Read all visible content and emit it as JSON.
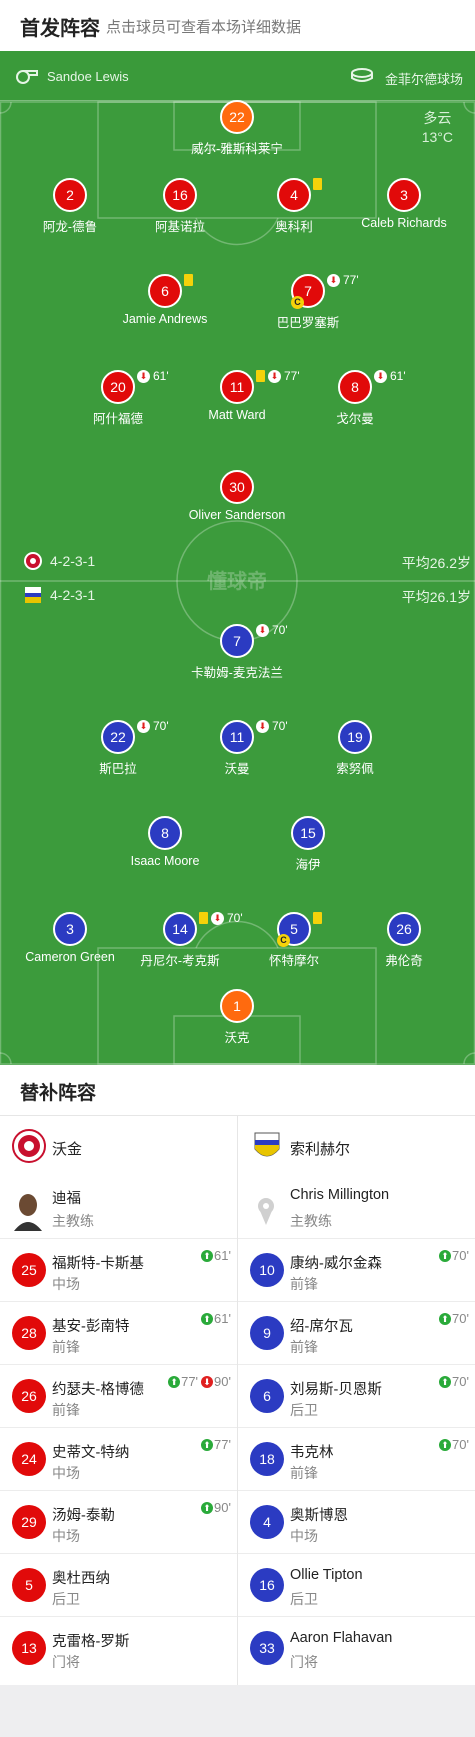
{
  "header": {
    "title": "首发阵容",
    "subtitle": "点击球员可查看本场详细数据"
  },
  "match": {
    "referee": "Sandoe Lewis",
    "venue": "金菲尔德球场",
    "weather": "多云",
    "temperature": "13°C",
    "watermark": "懂球帝"
  },
  "home": {
    "formation": "4-2-3-1",
    "avg_age": "平均26.2岁",
    "players": [
      {
        "num": "22",
        "name": "威尔-雅斯科莱宁",
        "gk": true
      },
      {
        "num": "2",
        "name": "阿龙-德鲁"
      },
      {
        "num": "16",
        "name": "阿基诺拉"
      },
      {
        "num": "4",
        "name": "奥科利",
        "yellow": true
      },
      {
        "num": "3",
        "name": "Caleb Richards"
      },
      {
        "num": "6",
        "name": "Jamie Andrews",
        "yellow": true
      },
      {
        "num": "7",
        "name": "巴巴罗塞斯",
        "sub_min": "77'",
        "captain": true
      },
      {
        "num": "20",
        "name": "阿什福德",
        "sub_min": "61'"
      },
      {
        "num": "11",
        "name": "Matt Ward",
        "yellow": true,
        "sub_min": "77'"
      },
      {
        "num": "8",
        "name": "戈尔曼",
        "sub_min": "61'"
      },
      {
        "num": "30",
        "name": "Oliver Sanderson"
      }
    ]
  },
  "away": {
    "formation": "4-2-3-1",
    "avg_age": "平均26.1岁",
    "players": [
      {
        "num": "7",
        "name": "卡勒姆-麦克法兰",
        "sub_min": "70'"
      },
      {
        "num": "22",
        "name": "斯巴拉",
        "sub_min": "70'"
      },
      {
        "num": "11",
        "name": "沃曼",
        "sub_min": "70'"
      },
      {
        "num": "19",
        "name": "索努佩"
      },
      {
        "num": "8",
        "name": "Isaac Moore"
      },
      {
        "num": "15",
        "name": "海伊"
      },
      {
        "num": "3",
        "name": "Cameron Green"
      },
      {
        "num": "14",
        "name": "丹尼尔-考克斯",
        "yellow": true,
        "sub_min": "70'"
      },
      {
        "num": "5",
        "name": "怀特摩尔",
        "yellow": true,
        "captain": true
      },
      {
        "num": "26",
        "name": "弗伦奇"
      },
      {
        "num": "1",
        "name": "沃克",
        "gk": true
      }
    ]
  },
  "subs": {
    "title": "替补阵容",
    "home": {
      "team": "沃金",
      "coach": "迪福",
      "coach_role": "主教练",
      "players": [
        {
          "num": "25",
          "name": "福斯特-卡斯基",
          "pos": "中场",
          "in": "61'"
        },
        {
          "num": "28",
          "name": "基安-彭南特",
          "pos": "前锋",
          "in": "61'"
        },
        {
          "num": "26",
          "name": "约瑟夫-格博德",
          "pos": "前锋",
          "in": "77'",
          "out": "90'"
        },
        {
          "num": "24",
          "name": "史蒂文-特纳",
          "pos": "中场",
          "in": "77'"
        },
        {
          "num": "29",
          "name": "汤姆-泰勒",
          "pos": "中场",
          "in": "90'"
        },
        {
          "num": "5",
          "name": "奥杜西纳",
          "pos": "后卫"
        },
        {
          "num": "13",
          "name": "克雷格-罗斯",
          "pos": "门将"
        }
      ]
    },
    "away": {
      "team": "索利赫尔",
      "coach": "Chris Millington",
      "coach_role": "主教练",
      "players": [
        {
          "num": "10",
          "name": "康纳-威尔金森",
          "pos": "前锋",
          "in": "70'"
        },
        {
          "num": "9",
          "name": "绍-席尔瓦",
          "pos": "前锋",
          "in": "70'"
        },
        {
          "num": "6",
          "name": "刘易斯-贝恩斯",
          "pos": "后卫",
          "in": "70'"
        },
        {
          "num": "18",
          "name": "韦克林",
          "pos": "前锋",
          "in": "70'"
        },
        {
          "num": "4",
          "name": "奥斯博恩",
          "pos": "中场"
        },
        {
          "num": "16",
          "name": "Ollie Tipton",
          "pos": "后卫"
        },
        {
          "num": "33",
          "name": "Aaron Flahavan",
          "pos": "门将"
        }
      ]
    }
  },
  "colors": {
    "home": "#e10a0a",
    "away": "#2b3bc2",
    "goalkeeper": "#ff6a0e",
    "pitch": "#3c9b3c",
    "yellow_card": "#f5d20a",
    "sub_in": "#2aaa3a",
    "sub_out": "#e02020"
  }
}
